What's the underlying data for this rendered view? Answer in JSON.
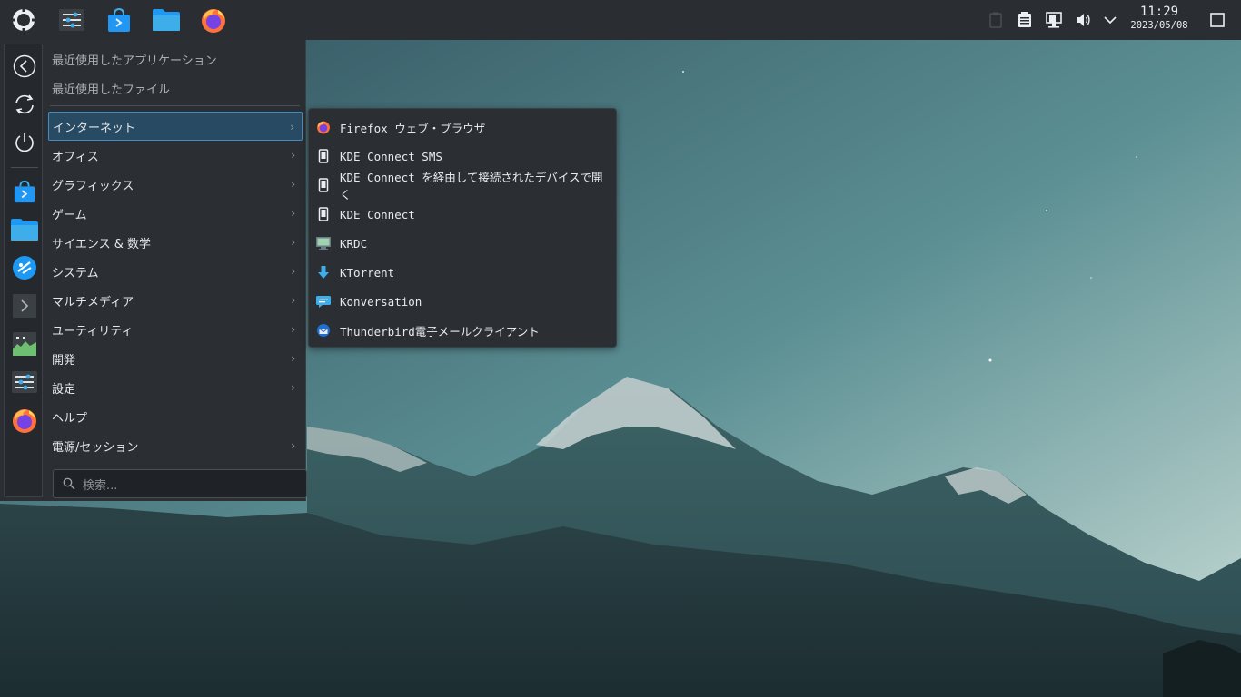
{
  "panel": {
    "clock_time": "11:29",
    "clock_date": "2023/05/08"
  },
  "launcher": {
    "recent_apps": "最近使用したアプリケーション",
    "recent_files": "最近使用したファイル",
    "categories": [
      {
        "label": "インターネット",
        "has_submenu": true,
        "active": true
      },
      {
        "label": "オフィス",
        "has_submenu": true
      },
      {
        "label": "グラフィックス",
        "has_submenu": true
      },
      {
        "label": "ゲーム",
        "has_submenu": true
      },
      {
        "label": "サイエンス & 数学",
        "has_submenu": true
      },
      {
        "label": "システム",
        "has_submenu": true
      },
      {
        "label": "マルチメディア",
        "has_submenu": true
      },
      {
        "label": "ユーティリティ",
        "has_submenu": true
      },
      {
        "label": "開発",
        "has_submenu": true
      },
      {
        "label": "設定",
        "has_submenu": true
      },
      {
        "label": "ヘルプ",
        "has_submenu": false
      },
      {
        "label": "電源/セッション",
        "has_submenu": true
      }
    ],
    "search_placeholder": "検索..."
  },
  "submenu": {
    "items": [
      {
        "label": "Firefox ウェブ・ブラウザ",
        "icon": "firefox-icon"
      },
      {
        "label": "KDE Connect SMS",
        "icon": "phone-icon"
      },
      {
        "label": "KDE Connect を経由して接続されたデバイスで開く",
        "icon": "phone-icon"
      },
      {
        "label": "KDE Connect",
        "icon": "phone-icon"
      },
      {
        "label": "KRDC",
        "icon": "remote-desktop-icon"
      },
      {
        "label": "KTorrent",
        "icon": "download-icon"
      },
      {
        "label": "Konversation",
        "icon": "chat-icon"
      },
      {
        "label": "Thunderbird電子メールクライアント",
        "icon": "thunderbird-icon"
      }
    ]
  },
  "colors": {
    "panel_bg": "#2a2e32",
    "menu_bg": "#2b2f33",
    "highlight": "#3d8ec8"
  }
}
